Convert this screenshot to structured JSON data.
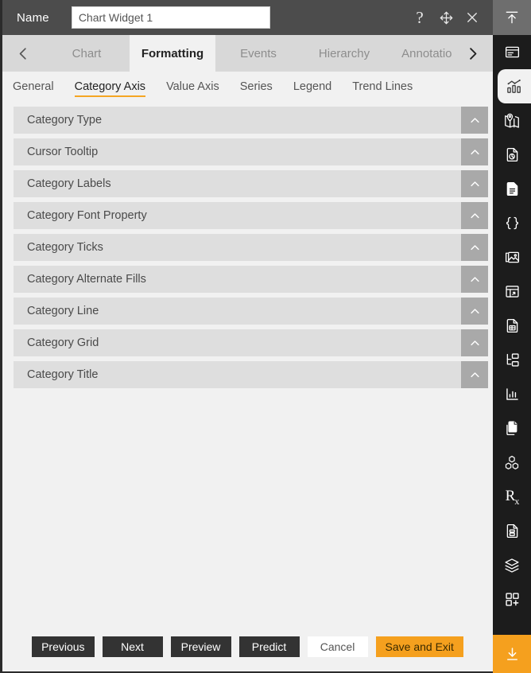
{
  "titlebar": {
    "name_label": "Name",
    "name_value": "Chart Widget 1",
    "name_placeholder": "Chart Widget 1",
    "help_icon": "question-mark-icon",
    "move_icon": "move-icon",
    "close_icon": "close-icon"
  },
  "tabs": {
    "prev_arrow": "chevron-left-icon",
    "next_arrow": "chevron-right-icon",
    "items": [
      {
        "label": "Chart",
        "active": false
      },
      {
        "label": "Formatting",
        "active": true
      },
      {
        "label": "Events",
        "active": false
      },
      {
        "label": "Hierarchy",
        "active": false
      },
      {
        "label": "Annotation",
        "active": false
      }
    ]
  },
  "subtabs": {
    "items": [
      {
        "label": "General",
        "active": false
      },
      {
        "label": "Category Axis",
        "active": true
      },
      {
        "label": "Value Axis",
        "active": false
      },
      {
        "label": "Series",
        "active": false
      },
      {
        "label": "Legend",
        "active": false
      },
      {
        "label": "Trend Lines",
        "active": false
      }
    ],
    "active_underline_color": "#f5a623"
  },
  "accordion": {
    "items": [
      {
        "label": "Category Type"
      },
      {
        "label": "Cursor Tooltip"
      },
      {
        "label": "Category Labels"
      },
      {
        "label": "Category Font Property"
      },
      {
        "label": "Category Ticks"
      },
      {
        "label": "Category Alternate Fills"
      },
      {
        "label": "Category Line"
      },
      {
        "label": "Category Grid"
      },
      {
        "label": "Category Title"
      }
    ],
    "toggle_icon": "chevron-up-icon"
  },
  "footer": {
    "buttons": [
      {
        "label": "Previous",
        "style": "dark"
      },
      {
        "label": "Next",
        "style": "dark"
      },
      {
        "label": "Preview",
        "style": "dark"
      },
      {
        "label": "Predict",
        "style": "dark"
      },
      {
        "label": "Cancel",
        "style": "light"
      },
      {
        "label": "Save and Exit",
        "style": "accent"
      }
    ]
  },
  "rail": {
    "items": [
      {
        "icon": "collapse-up-icon",
        "state": "collapse"
      },
      {
        "icon": "widget-card-icon",
        "state": "normal"
      },
      {
        "icon": "chart-icon",
        "state": "active"
      },
      {
        "icon": "map-pin-icon",
        "state": "normal"
      },
      {
        "icon": "pie-document-icon",
        "state": "normal"
      },
      {
        "icon": "document-icon",
        "state": "normal"
      },
      {
        "icon": "code-braces-icon",
        "state": "normal"
      },
      {
        "icon": "image-icon",
        "state": "normal"
      },
      {
        "icon": "table-widget-icon",
        "state": "normal"
      },
      {
        "icon": "report-document-icon",
        "state": "normal"
      },
      {
        "icon": "hierarchy-tree-icon",
        "state": "normal"
      },
      {
        "icon": "bar-chart-icon",
        "state": "normal"
      },
      {
        "icon": "copy-pages-icon",
        "state": "normal"
      },
      {
        "icon": "cubes-icon",
        "state": "normal"
      },
      {
        "icon": "prescription-rx-icon",
        "state": "normal"
      },
      {
        "icon": "save-document-icon",
        "state": "normal"
      },
      {
        "icon": "layers-icon",
        "state": "normal"
      },
      {
        "icon": "add-widget-icon",
        "state": "normal"
      },
      {
        "icon": "download-icon",
        "state": "accent"
      }
    ],
    "accent_color": "#f5a01e"
  }
}
